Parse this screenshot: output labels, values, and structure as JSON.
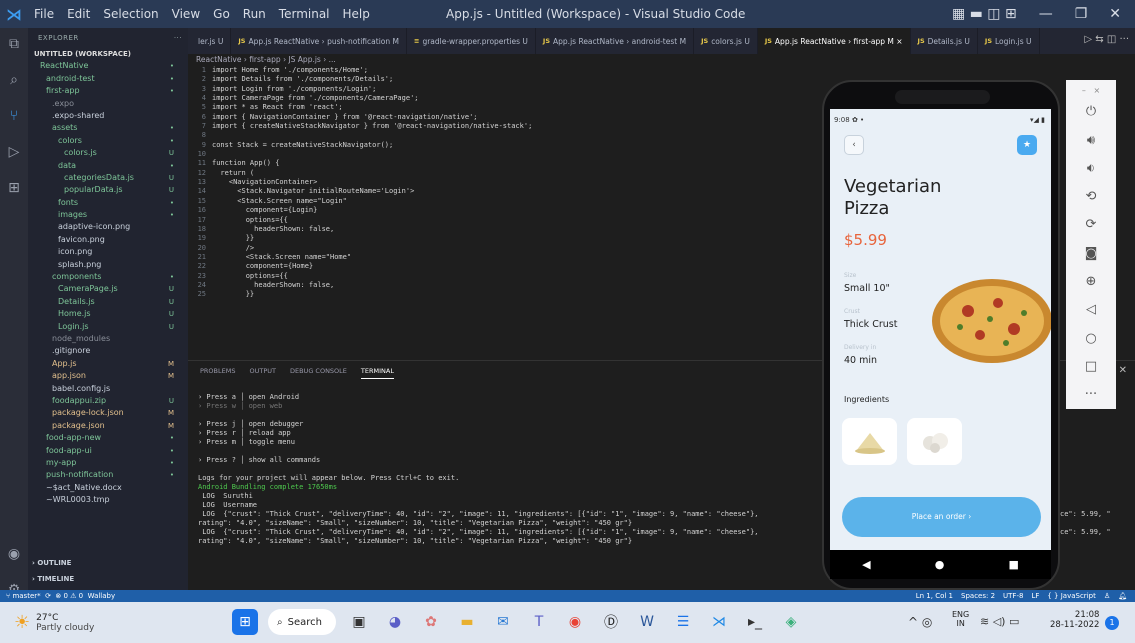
{
  "titlebar": {
    "menus": [
      "File",
      "Edit",
      "Selection",
      "View",
      "Go",
      "Run",
      "Terminal",
      "Help"
    ],
    "title": "App.js - Untitled (Workspace) - Visual Studio Code"
  },
  "explorer": {
    "header": "EXPLORER",
    "rows": [
      {
        "label": "UNTITLED (WORKSPACE)",
        "indent": 0,
        "status": "",
        "color": "#ddd"
      },
      {
        "label": "ReactNative",
        "indent": 1,
        "status": "•",
        "color": "#7ec699"
      },
      {
        "label": "android-test",
        "indent": 2,
        "status": "•",
        "color": "#7ec699"
      },
      {
        "label": "first-app",
        "indent": 2,
        "status": "•",
        "color": "#7ec699"
      },
      {
        "label": ".expo",
        "indent": 3,
        "status": "",
        "color": "#8a8f99"
      },
      {
        "label": ".expo-shared",
        "indent": 3,
        "status": "",
        "color": "#c9d1dc"
      },
      {
        "label": "assets",
        "indent": 3,
        "status": "•",
        "color": "#7ec699"
      },
      {
        "label": "colors",
        "indent": 4,
        "status": "•",
        "color": "#7ec699"
      },
      {
        "label": "colors.js",
        "indent": 5,
        "status": "U",
        "color": "#7ec699"
      },
      {
        "label": "data",
        "indent": 4,
        "status": "•",
        "color": "#7ec699"
      },
      {
        "label": "categoriesData.js",
        "indent": 5,
        "status": "U",
        "color": "#7ec699"
      },
      {
        "label": "popularData.js",
        "indent": 5,
        "status": "U",
        "color": "#7ec699"
      },
      {
        "label": "fonts",
        "indent": 4,
        "status": "•",
        "color": "#7ec699"
      },
      {
        "label": "images",
        "indent": 4,
        "status": "•",
        "color": "#7ec699"
      },
      {
        "label": "adaptive-icon.png",
        "indent": 4,
        "status": "",
        "color": "#c9d1dc"
      },
      {
        "label": "favicon.png",
        "indent": 4,
        "status": "",
        "color": "#c9d1dc"
      },
      {
        "label": "icon.png",
        "indent": 4,
        "status": "",
        "color": "#c9d1dc"
      },
      {
        "label": "splash.png",
        "indent": 4,
        "status": "",
        "color": "#c9d1dc"
      },
      {
        "label": "components",
        "indent": 3,
        "status": "•",
        "color": "#7ec699"
      },
      {
        "label": "CameraPage.js",
        "indent": 4,
        "status": "U",
        "color": "#7ec699"
      },
      {
        "label": "Details.js",
        "indent": 4,
        "status": "U",
        "color": "#7ec699"
      },
      {
        "label": "Home.js",
        "indent": 4,
        "status": "U",
        "color": "#7ec699"
      },
      {
        "label": "Login.js",
        "indent": 4,
        "status": "U",
        "color": "#7ec699"
      },
      {
        "label": "node_modules",
        "indent": 3,
        "status": "",
        "color": "#8a8f99"
      },
      {
        "label": ".gitignore",
        "indent": 3,
        "status": "",
        "color": "#c9d1dc"
      },
      {
        "label": "App.js",
        "indent": 3,
        "status": "M",
        "color": "#e2c08d"
      },
      {
        "label": "app.json",
        "indent": 3,
        "status": "M",
        "color": "#e2c08d"
      },
      {
        "label": "babel.config.js",
        "indent": 3,
        "status": "",
        "color": "#c9d1dc"
      },
      {
        "label": "foodappui.zip",
        "indent": 3,
        "status": "U",
        "color": "#7ec699"
      },
      {
        "label": "package-lock.json",
        "indent": 3,
        "status": "M",
        "color": "#e2c08d"
      },
      {
        "label": "package.json",
        "indent": 3,
        "status": "M",
        "color": "#e2c08d"
      },
      {
        "label": "food-app-new",
        "indent": 2,
        "status": "•",
        "color": "#7ec699"
      },
      {
        "label": "food-app-ui",
        "indent": 2,
        "status": "•",
        "color": "#7ec699"
      },
      {
        "label": "my-app",
        "indent": 2,
        "status": "•",
        "color": "#7ec699"
      },
      {
        "label": "push-notification",
        "indent": 2,
        "status": "•",
        "color": "#7ec699"
      },
      {
        "label": "~$act_Native.docx",
        "indent": 2,
        "status": "",
        "color": "#c9d1dc"
      },
      {
        "label": "~WRL0003.tmp",
        "indent": 2,
        "status": "",
        "color": "#c9d1dc"
      }
    ],
    "outline": "OUTLINE",
    "timeline": "TIMELINE"
  },
  "tabs": [
    {
      "js": "",
      "label": "ler.js U"
    },
    {
      "js": "JS",
      "label": "App.js ReactNative › push-notification M"
    },
    {
      "js": "≡",
      "label": "gradle-wrapper.properties U"
    },
    {
      "js": "JS",
      "label": "App.js ReactNative › android-test M"
    },
    {
      "js": "JS",
      "label": "colors.js U"
    },
    {
      "js": "JS",
      "label": "App.js ReactNative › first-app M  ×",
      "active": true
    },
    {
      "js": "JS",
      "label": "Details.js U"
    },
    {
      "js": "JS",
      "label": "Login.js U"
    }
  ],
  "breadcrumb": "ReactNative › first-app › JS App.js › ...",
  "code": [
    [
      "1",
      "import Home from './components/Home';"
    ],
    [
      "2",
      "import Details from './components/Details';"
    ],
    [
      "3",
      "import Login from './components/Login';"
    ],
    [
      "4",
      "import CameraPage from './components/CameraPage';"
    ],
    [
      "5",
      "import * as React from 'react';"
    ],
    [
      "6",
      "import { NavigationContainer } from '@react-navigation/native';"
    ],
    [
      "7",
      "import { createNativeStackNavigator } from '@react-navigation/native-stack';"
    ],
    [
      "8",
      ""
    ],
    [
      "9",
      "const Stack = createNativeStackNavigator();"
    ],
    [
      "10",
      ""
    ],
    [
      "11",
      "function App() {"
    ],
    [
      "12",
      "  return ("
    ],
    [
      "13",
      "    <NavigationContainer>"
    ],
    [
      "14",
      "      <Stack.Navigator initialRouteName='Login'>"
    ],
    [
      "15",
      "      <Stack.Screen name=\"Login\""
    ],
    [
      "16",
      "        component={Login}"
    ],
    [
      "17",
      "        options={{"
    ],
    [
      "18",
      "          headerShown: false,"
    ],
    [
      "19",
      "        }}"
    ],
    [
      "20",
      "        />"
    ],
    [
      "21",
      "        <Stack.Screen name=\"Home\""
    ],
    [
      "22",
      "        component={Home}"
    ],
    [
      "23",
      "        options={{"
    ],
    [
      "24",
      "          headerShown: false,"
    ],
    [
      "25",
      "        }}"
    ]
  ],
  "panel": {
    "tabs": [
      "PROBLEMS",
      "OUTPUT",
      "DEBUG CONSOLE",
      "TERMINAL"
    ],
    "lines": [
      {
        "t": "› Press a │ open Android",
        "c": ""
      },
      {
        "t": "› Press w │ open web",
        "c": "dim"
      },
      {
        "t": "",
        "c": ""
      },
      {
        "t": "› Press j │ open debugger",
        "c": ""
      },
      {
        "t": "› Press r │ reload app",
        "c": ""
      },
      {
        "t": "› Press m │ toggle menu",
        "c": ""
      },
      {
        "t": "",
        "c": ""
      },
      {
        "t": "› Press ? │ show all commands",
        "c": ""
      },
      {
        "t": "",
        "c": ""
      },
      {
        "t": "Logs for your project will appear below. Press Ctrl+C to exit.",
        "c": ""
      },
      {
        "t": "Android Bundling complete 17650ms",
        "c": "grn"
      },
      {
        "t": " LOG  Suruthi",
        "c": ""
      },
      {
        "t": " LOG  Username",
        "c": ""
      },
      {
        "t": " LOG  {\"crust\": \"Thick Crust\", \"deliveryTime\": 40, \"id\": \"2\", \"image\": 11, \"ingredients\": [{\"id\": \"1\", \"image\": 9, \"name\": \"cheese\"},",
        "c": ""
      },
      {
        "t": "rating\": \"4.0\", \"sizeName\": \"Small\", \"sizeNumber\": 10, \"title\": \"Vegetarian Pizza\", \"weight\": \"450 gr\"}",
        "c": ""
      },
      {
        "t": " LOG  {\"crust\": \"Thick Crust\", \"deliveryTime\": 40, \"id\": \"2\", \"image\": 11, \"ingredients\": [{\"id\": \"1\", \"image\": 9, \"name\": \"cheese\"},",
        "c": ""
      },
      {
        "t": "rating\": \"4.0\", \"sizeName\": \"Small\", \"sizeNumber\": 10, \"title\": \"Vegetarian Pizza\", \"weight\": \"450 gr\"}",
        "c": ""
      }
    ],
    "right1": "ce\": 5.99, \"",
    "right2": "ce\": 5.99, \""
  },
  "status": {
    "branch": "master*",
    "sync": "⟳",
    "problems": "⊗ 0 ⚠ 0",
    "wallaby": "Wallaby",
    "position": "Ln 1, Col 1",
    "spaces": "Spaces: 2",
    "encoding": "UTF-8",
    "eol": "LF",
    "lang": "{ } JavaScript"
  },
  "phone": {
    "time": "9:08",
    "title1": "Vegetarian",
    "title2": "Pizza",
    "price": "$5.99",
    "size_label": "Size",
    "size": "Small 10\"",
    "crust_label": "Crust",
    "crust": "Thick Crust",
    "delivery_label": "Delivery in",
    "delivery": "40 min",
    "ingredients": "Ingredients",
    "order": "Place an order  ›"
  },
  "taskbar": {
    "temp": "27°C",
    "weather": "Partly cloudy",
    "search": "Search",
    "lang1": "ENG",
    "lang2": "IN",
    "time": "21:08",
    "date": "28-11-2022"
  },
  "colors": {
    "accent": "#1f5fa8",
    "price": "#e8643c",
    "order_btn": "#5bb3ea"
  }
}
